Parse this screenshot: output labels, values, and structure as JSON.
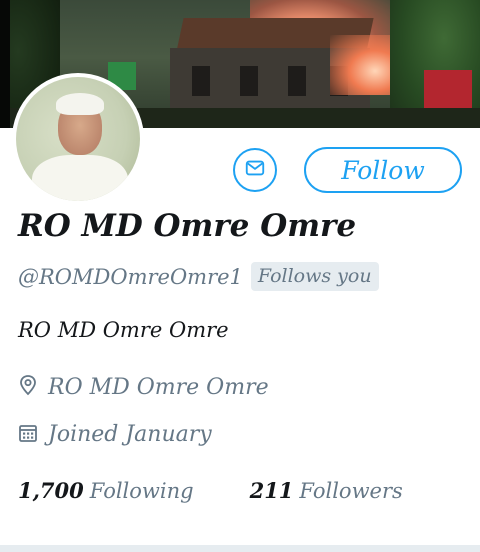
{
  "profile": {
    "name": "RO MD Omre Omre",
    "handle": "@ROMDOmreOmre1",
    "follows_you": "Follows you",
    "bio": "RO MD Omre Omre",
    "location": "RO MD Omre Omre",
    "joined": "Joined January"
  },
  "stats": {
    "following_count": "1,700",
    "following_label": "Following",
    "followers_count": "211",
    "followers_label": "Followers"
  },
  "actions": {
    "follow_label": "Follow",
    "message_icon": "mail-icon"
  },
  "icons": {
    "location": "location-pin-icon",
    "joined": "calendar-icon"
  },
  "colors": {
    "accent": "#1da1f2",
    "text_primary": "#14171a",
    "text_secondary": "#657786",
    "badge_bg": "#e6ecf0"
  }
}
